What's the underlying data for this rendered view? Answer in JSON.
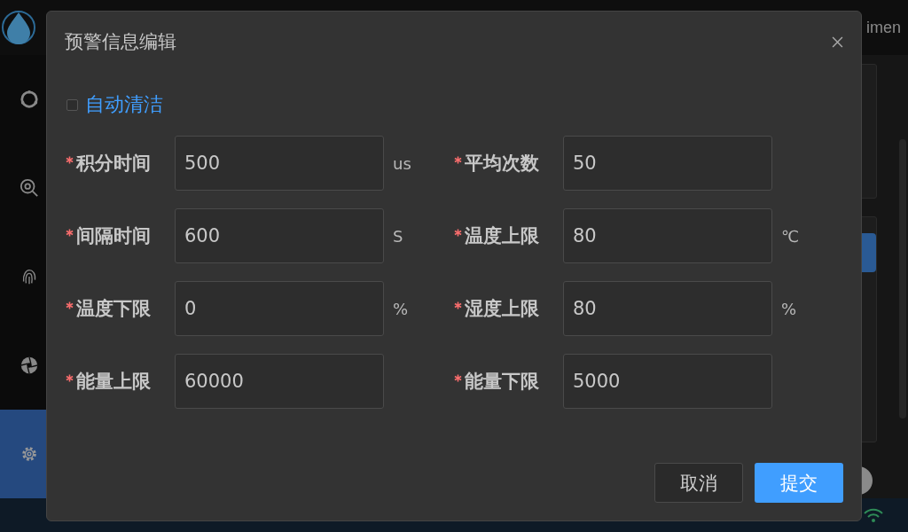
{
  "header": {
    "title": "imen"
  },
  "sidebar": {
    "items": [
      {
        "selected": false
      },
      {
        "selected": false
      },
      {
        "selected": false
      },
      {
        "selected": false
      },
      {
        "selected": true
      }
    ]
  },
  "dialog": {
    "title": "预警信息编辑",
    "checkbox": {
      "label": "自动清洁",
      "checked": false
    },
    "fields": [
      {
        "label": "积分时间",
        "required": true,
        "value": "500",
        "unit": "us"
      },
      {
        "label": "平均次数",
        "required": true,
        "value": "50"
      },
      {
        "label": "间隔时间",
        "required": true,
        "value": "600",
        "unit": "S"
      },
      {
        "label": "温度上限",
        "required": true,
        "value": "80",
        "unit": "℃"
      },
      {
        "label": "温度下限",
        "required": true,
        "value": "0",
        "unit": "%"
      },
      {
        "label": "湿度上限",
        "required": true,
        "value": "80",
        "unit": "%"
      },
      {
        "label": "能量上限",
        "required": true,
        "value": "60000"
      },
      {
        "label": "能量下限",
        "required": true,
        "value": "5000"
      }
    ],
    "buttons": [
      {
        "label": "取消",
        "kind": "default"
      },
      {
        "label": "提交",
        "kind": "primary"
      }
    ]
  }
}
